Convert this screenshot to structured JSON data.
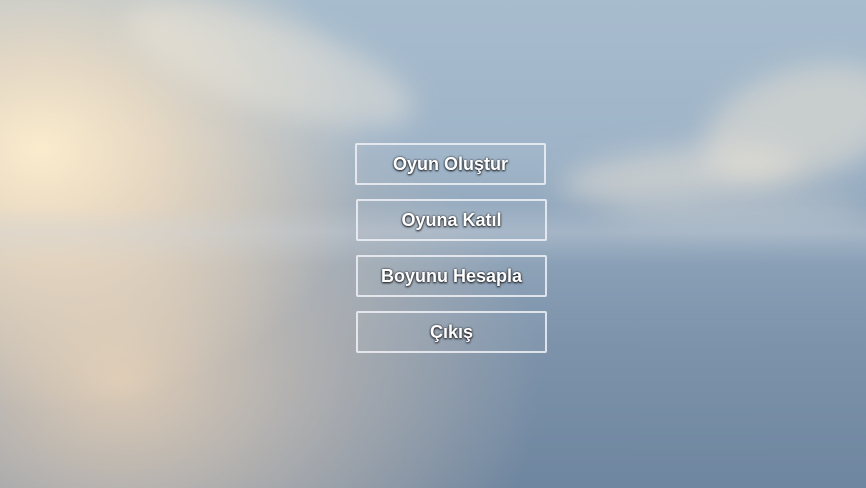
{
  "main_menu": {
    "buttons": [
      {
        "label": "Oyun Oluştur"
      },
      {
        "label": "Oyuna Katıl"
      },
      {
        "label": "Boyunu Hesapla"
      },
      {
        "label": "Çıkış"
      }
    ]
  },
  "colors": {
    "button_border": "#eef0f4",
    "button_text": "#ffffff",
    "sky_top": "#a7bccd",
    "sky_bottom": "#6f86a0",
    "sun_glow": "#ffeecd"
  }
}
